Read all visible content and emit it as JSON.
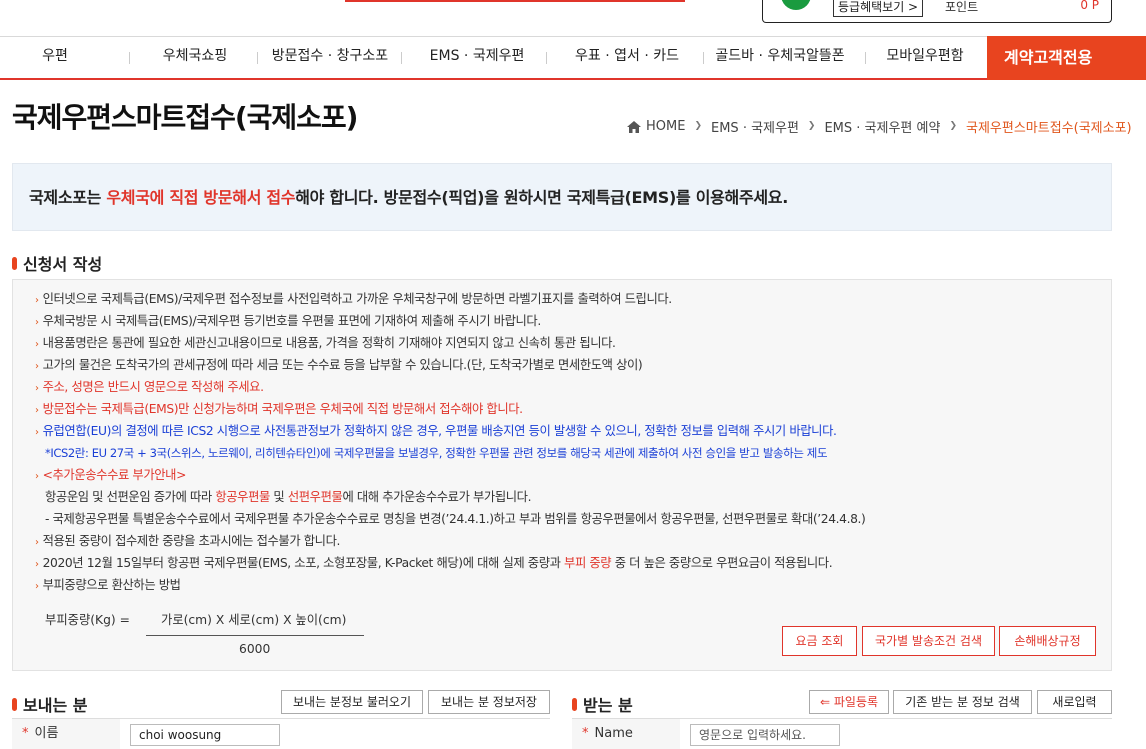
{
  "top": {
    "grade_button": "등급혜택보기 >",
    "point_label": "포인트",
    "point_value": "0 P"
  },
  "gnb": {
    "items": [
      "우편",
      "우체국쇼핑",
      "방문접수 · 창구소포",
      "EMS · 국제우편",
      "우표 · 엽서 · 카드",
      "골드바 · 우체국알뜰폰",
      "모바일우편함"
    ],
    "special": "계약고객전용"
  },
  "page": {
    "title": "국제우편스마트접수(국제소포)"
  },
  "breadcrumb": {
    "home": "HOME",
    "items": [
      "EMS · 국제우편",
      "EMS · 국제우편 예약"
    ],
    "current": "국제우편스마트접수(국제소포)"
  },
  "notice": {
    "pre": "국제소포는 ",
    "highlight": "우체국에 직접 방문해서 접수",
    "post": "해야 합니다. 방문접수(픽업)을 원하시면 국제특급(EMS)를 이용해주세요."
  },
  "application": {
    "title": "신청서 작성",
    "lines": [
      "인터넷으로 국제특급(EMS)/국제우편 접수정보를 사전입력하고 가까운 우체국창구에 방문하면 라벨기표지를 출력하여 드립니다.",
      "우체국방문 시 국제특급(EMS)/국제우편 등기번호를 우편물 표면에 기재하여 제출해 주시기 바랍니다.",
      "내용품명란은 통관에 필요한 세관신고내용이므로 내용품, 가격을 정확히 기재해야 지연되지 않고 신속히 통관 됩니다.",
      "고가의 물건은 도착국가의 관세규정에 따라 세금 또는 수수료 등을 납부할 수 있습니다.(단, 도착국가별로 면세한도액 상이)",
      "주소, 성명은 반드시 영문으로 작성해 주세요.",
      "방문접수는 국제특급(EMS)만 신청가능하며 국제우편은 우체국에 직접 방문해서 접수해야 합니다.",
      "유럽연합(EU)의 결정에 따른 ICS2 시행으로 사전통관정보가 정확하지 않은 경우, 우편물 배송지연 등이 발생할 수 있으니, 정확한 정보를 입력해 주시기 바랍니다.",
      "*ICS2란: EU 27국 + 3국(스위스, 노르웨이, 리히텐슈타인)에 국제우편물을 보낼경우, 정확한 우편물 관련 정보를 해당국 세관에 제출하여 사전 승인을 받고 발송하는 제도",
      "<추가운송수수료 부가안내>",
      "항공운임 및 선편운임 증가에 따라 ",
      "항공우편물",
      " 및 ",
      "선편우편물",
      "에 대해 추가운송수수료가 부가됩니다.",
      "- 국제항공우편물 특별운송수수료에서 국제우편물 추가운송수수료로 명칭을 변경(’24.4.1.)하고 부과 범위를 항공우편물에서 항공우편물, 선편우편물로 확대(’24.4.8.)",
      "적용된 중량이 접수제한 중량을 초과시에는 접수불가 합니다.",
      "2020년 12월 15일부터 항공편 국제우편물(EMS, 소포, 소형포장물, K-Packet 해당)에 대해 실제 중량과 ",
      "부피 중량",
      " 중 더 높은 중량으로 우편요금이 적용됩니다.",
      "부피중량으로 환산하는 방법"
    ],
    "formula_label": "부피중량(Kg) =",
    "formula_top": "가로(cm) X 세로(cm) X 높이(cm)",
    "formula_bottom": "6000",
    "buttons": [
      "요금 조회",
      "국가별 발송조건 검색",
      "손해배상규정"
    ]
  },
  "sender": {
    "title": "보내는 분",
    "load_button": "보내는 분정보 불러오기",
    "save_button": "보내는 분 정보저장",
    "name_label": "이름",
    "name_value": "choi woosung"
  },
  "receiver": {
    "title": "받는 분",
    "file_button": "파일등록",
    "search_button": "기존 받는 분 정보 검색",
    "new_button": "새로입력",
    "name_label": "Name",
    "name_placeholder": "영문으로 입력하세요."
  },
  "colors": {
    "accent": "#e0352b",
    "gnb_special": "#e8441f",
    "notice_bg": "#eef4fa",
    "link_blue": "#1a3fd6"
  }
}
